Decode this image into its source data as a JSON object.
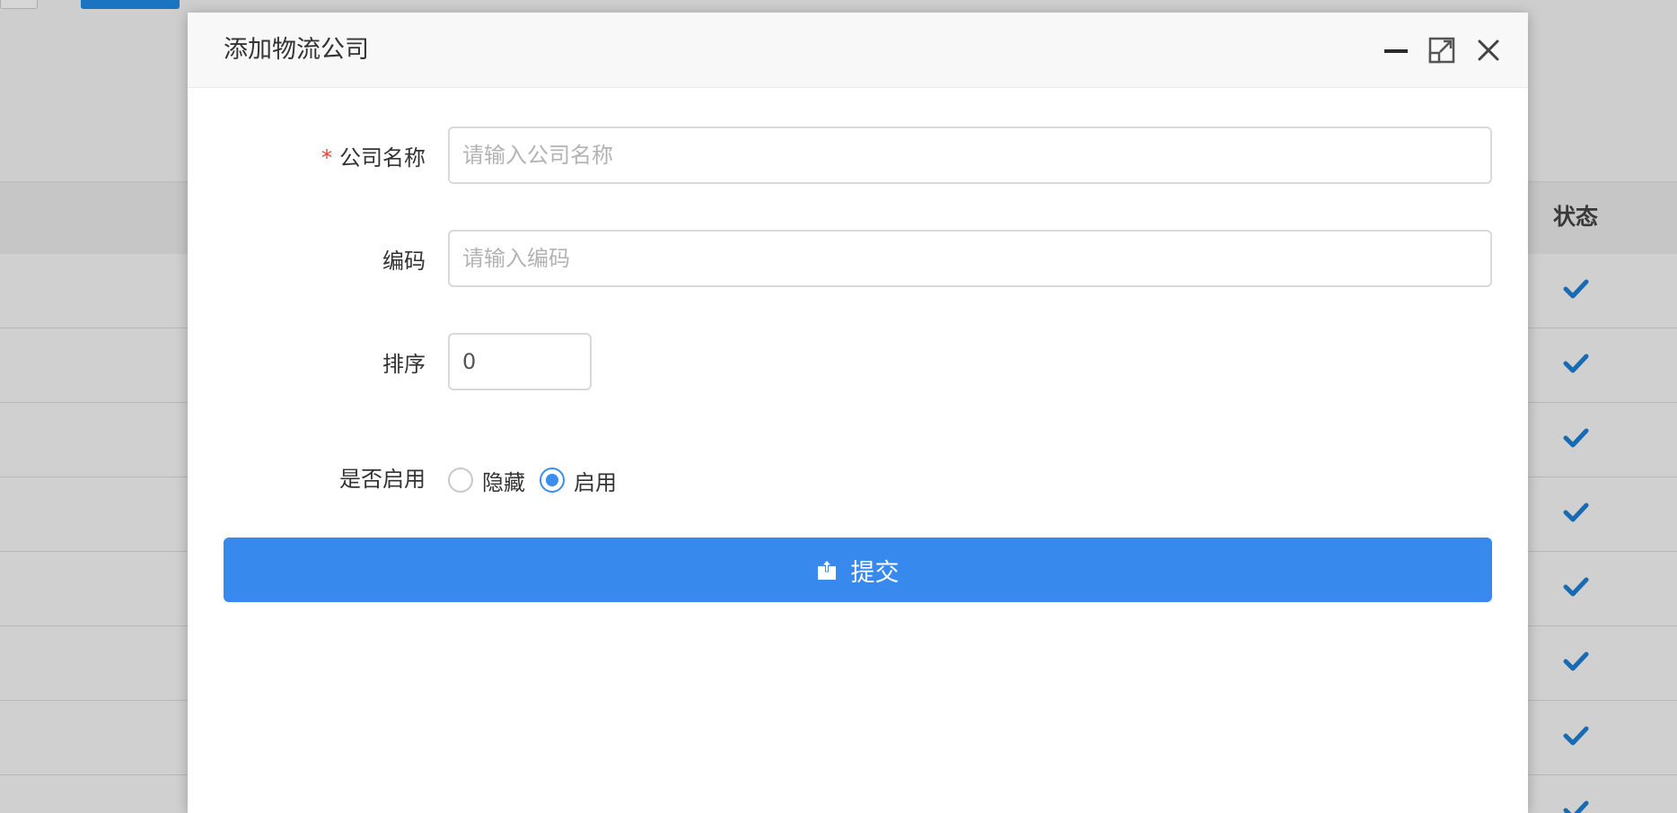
{
  "background": {
    "table": {
      "status_header": "状态"
    }
  },
  "dialog": {
    "title": "添加物流公司",
    "header_icons": [
      "minimize-icon",
      "maximize-icon",
      "close-icon"
    ],
    "form": {
      "company_name": {
        "required_mark": "*",
        "label": "公司名称",
        "placeholder": "请输入公司名称",
        "value": ""
      },
      "code": {
        "label": "编码",
        "placeholder": "请输入编码",
        "value": ""
      },
      "sort": {
        "label": "排序",
        "value": "0"
      },
      "enabled": {
        "label": "是否启用",
        "options": [
          {
            "label": "隐藏",
            "checked": false
          },
          {
            "label": "启用",
            "checked": true
          }
        ]
      }
    },
    "submit": {
      "label": "提交",
      "icon": "upload-icon"
    }
  },
  "colors": {
    "primary": "#3889ee",
    "radio_checked": "#3a8ef0",
    "required": "#e0432f",
    "check_icon": "#1d7fd4"
  }
}
